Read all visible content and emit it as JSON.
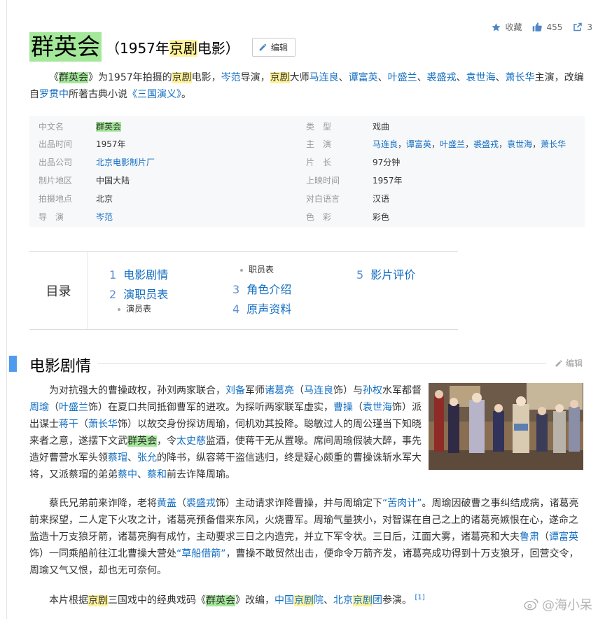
{
  "actions": {
    "collect_label": "收藏",
    "like_count": "455",
    "share_count": "3"
  },
  "title": {
    "main": "群英会",
    "sub_prefix": "（1957年",
    "sub_hl": "京剧",
    "sub_suffix": "电影）",
    "edit_label": "编辑"
  },
  "intro": {
    "t1": "《",
    "t2": "群英会",
    "t3": "》为1957年拍摄的",
    "t4": "京剧",
    "t5": "电影，",
    "l1": "岑范",
    "t6": "导演，",
    "t7": "京剧",
    "t8": "大师",
    "l2": "马连良",
    "s1": "、",
    "l3": "谭富英",
    "s2": "、",
    "l4": "叶盛兰",
    "s3": "、",
    "l5": "裘盛戎",
    "s4": "、",
    "l6": "袁世海",
    "s5": "、",
    "l7": "萧长华",
    "t9": "主演，改编自",
    "l8": "罗贯中",
    "t10": "所著古典小说",
    "l9": "《三国演义》",
    "t11": "。"
  },
  "basic_info": {
    "r1": {
      "k1": "中文名",
      "v1": "群英会",
      "k2": "类　型",
      "v2": "戏曲"
    },
    "r2": {
      "k1": "出品时间",
      "v1": "1957年",
      "k2": "主　演",
      "cast": [
        "马连良",
        "谭富英",
        "叶盛兰",
        "裘盛戎",
        "袁世海",
        "萧长华"
      ],
      "sep": "，"
    },
    "r3": {
      "k1": "出品公司",
      "v1": "北京电影制片厂",
      "k2": "片　长",
      "v2": "97分钟"
    },
    "r4": {
      "k1": "制片地区",
      "v1": "中国大陆",
      "k2": "上映时间",
      "v2": "1957年"
    },
    "r5": {
      "k1": "拍摄地点",
      "v1": "北京",
      "k2": "对白语言",
      "v2": "汉语"
    },
    "r6": {
      "k1": "导　演",
      "v1": "岑范",
      "k2": "色　彩",
      "v2": "彩色"
    }
  },
  "catalog": {
    "label": "目录",
    "items": [
      {
        "num": "1",
        "label": "电影剧情"
      },
      {
        "num": "2",
        "label": "演职员表"
      },
      {
        "num": "3",
        "label": "角色介绍"
      },
      {
        "num": "4",
        "label": "原声资料"
      },
      {
        "num": "5",
        "label": "影片评价"
      }
    ],
    "sub1": "演员表",
    "sub2": "职员表"
  },
  "section": {
    "title": "电影剧情",
    "edit_label": "编辑"
  },
  "p1": {
    "a": "为对抗强大的曹操政权，孙刘两家联合，",
    "l1": "刘备",
    "b": "军师",
    "l2": "诸葛亮",
    "c": "（",
    "l3": "马连良",
    "d": "饰）与",
    "l4": "孙权",
    "e": "水军都督",
    "l5": "周瑜",
    "f": "（",
    "l6": "叶盛兰",
    "g": "饰）在夏口共同抵御曹军的进攻。为探听两家联军虚实，",
    "l7": "曹操",
    "h": "（",
    "l8": "袁世海",
    "i": "饰）派出谋士",
    "l9": "蒋干",
    "j": "（",
    "l10": "萧长华",
    "k": "饰）以故交身份探访周瑜，伺机劝其投降。聪敏过人的周公瑾当下知晓来者之意，遂摆下文武",
    "hl": "群英会",
    "m": "，令",
    "l11": "太史慈",
    "n": "监酒，使蒋干无从置喙。席间周瑜假装大醉，事先造好曹营水军头领",
    "l12": "蔡瑁",
    "o": "、",
    "l13": "张允",
    "p": "的降书，纵容蒋干盗信逃归，终是疑心颇重的曹操诛斩水军大将，又派蔡瑁的弟弟",
    "l14": "蔡中",
    "q": "、",
    "l15": "蔡和",
    "r": "前去诈降周瑜。"
  },
  "p2": {
    "a": "蔡氏兄弟前来诈降，老将",
    "l1": "黄盖",
    "b": "（",
    "l2": "裘盛戎",
    "c": "饰）主动请求诈降曹操，并与周瑜定下",
    "l3": "“苦肉计”",
    "d": "。周瑜因破曹之事纠结成病，诸葛亮前来探望，二人定下火攻之计，诸葛亮预备借来东风，火烧曹军。周瑜气量狭小，对智谋在自己之上的诸葛亮嫉恨在心，遂命之监造十万支狼牙箭，诸葛亮胸有成竹，主动要求三日之内造完，并立下军令状。三日后，江面大雾，诸葛亮和大夫",
    "l4": "鲁肃",
    "e": "（",
    "l5": "谭富英",
    "f": "饰）一同乘船前往江北曹操大营处",
    "l6": "“草船借箭”",
    "g": "，曹操不敢贸然出击，便命令万箭齐发，诸葛亮成功得到十万支狼牙，回营交令，周瑜又气又恨，却也无可奈何。"
  },
  "p3": {
    "a": "本片根据",
    "h1": "京剧",
    "b": "三国戏中的经典戏码《",
    "h2": "群英会",
    "c": "》改编，",
    "l1": "中国",
    "h3": "京剧",
    "l2": "院",
    "d": "、",
    "l3": "北京",
    "h4": "京剧",
    "l4": "团",
    "e": "参演。",
    "ref": "[1]"
  },
  "watermark": "@海小呆",
  "colors": {
    "link": "#136ec2",
    "highlight_green": "#a4e89a",
    "highlight_yellow": "#fff29a",
    "section_bar": "#4f9cee"
  }
}
